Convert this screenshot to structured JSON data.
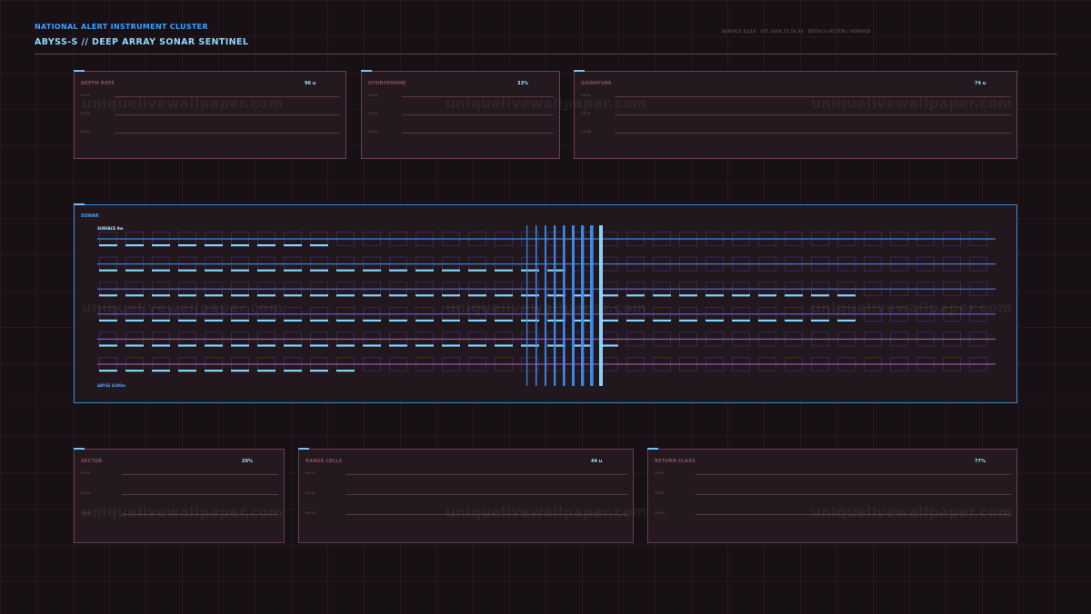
{
  "header": {
    "subtitle": "NATIONAL ALERT INSTRUMENT CLUSTER",
    "title": "ABYSS-S  //  DEEP ARRAY SONAR SENTINEL",
    "meta": "SURFACE 02/16 · UTC LOCK 21:54:34 · DOTSCH VECTOR / VERIFIED"
  },
  "top_panels": [
    {
      "label": "DEPTH RATE",
      "value": "96 u",
      "rows": [
        "CH 01",
        "CH 02",
        "CH 03"
      ]
    },
    {
      "label": "HYDROPHONE",
      "value": "33%",
      "rows": [
        "CH 01",
        "CH 02",
        "CH 03"
      ]
    },
    {
      "label": "SIGNATURE",
      "value": "74 u",
      "rows": [
        "CH 01",
        "CH 02",
        "CH 03"
      ]
    }
  ],
  "sonar": {
    "label": "SONAR",
    "top_label": "SURFACE  0m",
    "bottom_label": "ABYSS  4200m",
    "row_fill_cells": [
      9,
      18,
      29,
      29,
      20,
      10
    ],
    "row_colors": [
      "#3a8fe8",
      "#4a7ee8",
      "#6070e0",
      "#7866d8",
      "#8a5cc8",
      "#9a58b8"
    ],
    "pulse_columns": 9,
    "total_cells": 34
  },
  "bottom_panels": [
    {
      "label": "SECTOR",
      "value": "29%",
      "rows": [
        "CH 01",
        "CH 02",
        "CH 03"
      ]
    },
    {
      "label": "RANGE CELLS",
      "value": "44 u",
      "rows": [
        "CH 01",
        "CH 02",
        "CH 03"
      ]
    },
    {
      "label": "RETURN CLASS",
      "value": "77%",
      "rows": [
        "CH 01",
        "CH 02",
        "CH 03"
      ]
    }
  ],
  "watermark": "uniquelivewallpaper.com",
  "colors": {
    "accent": "#3fa0ff",
    "cyan": "#7fd8ff",
    "panel_border": "#6b3c55",
    "sonar_border": "#3a8bd6"
  }
}
